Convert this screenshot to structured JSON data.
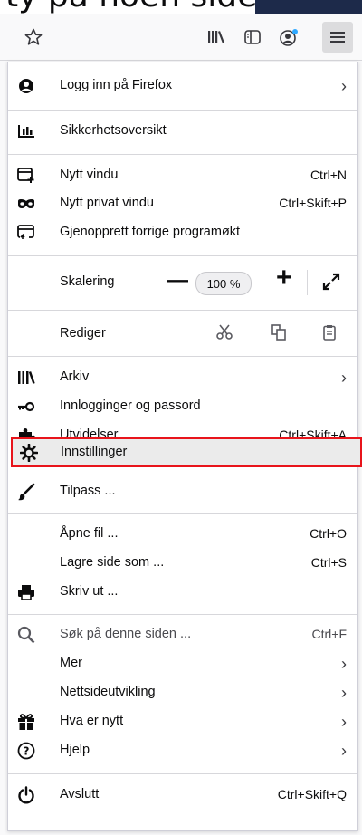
{
  "header": {
    "clipped_text": "ty på noen sider og"
  },
  "toolbar": {
    "icons": [
      "star-icon",
      "library-icon",
      "sidebar-icon",
      "account-icon",
      "hamburger-menu-icon"
    ]
  },
  "menu": {
    "sign_in": "Logg inn på Firefox",
    "security": "Sikkerhetsoversikt",
    "new_window": "Nytt vindu",
    "new_window_sc": "Ctrl+N",
    "new_private": "Nytt privat vindu",
    "new_private_sc": "Ctrl+Skift+P",
    "restore": "Gjenopprett forrige programøkt",
    "zoom_label": "Skalering",
    "zoom_minus": "—",
    "zoom_value": "100 %",
    "zoom_plus": "+",
    "edit_label": "Rediger",
    "library": "Arkiv",
    "logins": "Innlogginger og passord",
    "addons": "Utvidelser",
    "addons_sc": "Ctrl+Skift+A",
    "options": "Innstillinger",
    "customize": "Tilpass ...",
    "open_file": "Åpne fil ...",
    "open_file_sc": "Ctrl+O",
    "save_page": "Lagre side som ...",
    "save_page_sc": "Ctrl+S",
    "print": "Skriv ut ...",
    "find": "Søk på denne siden ...",
    "find_sc": "Ctrl+F",
    "more": "Mer",
    "webdev": "Nettsideutvikling",
    "whats_new": "Hva er nytt",
    "help": "Hjelp",
    "quit": "Avslutt",
    "quit_sc": "Ctrl+Skift+Q"
  },
  "colors": {
    "highlight_border": "#e8141b",
    "navy": "#1d2a4a"
  }
}
